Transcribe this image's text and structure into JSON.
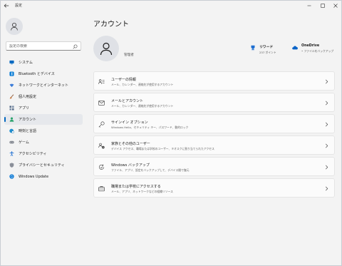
{
  "window": {
    "title": "設定"
  },
  "search": {
    "placeholder": "設定の検索"
  },
  "sidebar": {
    "items": [
      {
        "label": "システム",
        "icon": "monitor-icon",
        "color": "#0067c0"
      },
      {
        "label": "Bluetooth とデバイス",
        "icon": "bluetooth-icon",
        "color": "#0078d4"
      },
      {
        "label": "ネットワークとインターネット",
        "icon": "wifi-icon",
        "color": "#3b7bd8"
      },
      {
        "label": "個人用設定",
        "icon": "brush-icon",
        "color": "#c4743a"
      },
      {
        "label": "アプリ",
        "icon": "apps-icon",
        "color": "#5a6f8a"
      },
      {
        "label": "アカウント",
        "icon": "person-icon",
        "color": "#2aa36b",
        "active": true
      },
      {
        "label": "時刻と言語",
        "icon": "globe-clock-icon",
        "color": "#1f8fd0"
      },
      {
        "label": "ゲーム",
        "icon": "gamepad-icon",
        "color": "#7a7f88"
      },
      {
        "label": "アクセシビリティ",
        "icon": "accessibility-icon",
        "color": "#1f6fd1"
      },
      {
        "label": "プライバシーとセキュリティ",
        "icon": "shield-icon",
        "color": "#8a8f99"
      },
      {
        "label": "Windows Update",
        "icon": "update-icon",
        "color": "#0a78d4"
      }
    ]
  },
  "main": {
    "title": "アカウント",
    "account_role": "管理者",
    "rewards": {
      "title": "リワード",
      "sub": "237 ポイント"
    },
    "onedrive": {
      "title": "OneDrive",
      "sub": "• ファイルをバックアップ"
    },
    "cards": [
      {
        "title": "ユーザーの情報",
        "sub": "メール、カレンダー、連絡先が使用するアカウント",
        "icon": "user-info-icon"
      },
      {
        "title": "メールとアカウント",
        "sub": "メール、カレンダー、連絡先が使用するアカウント",
        "icon": "mail-icon"
      },
      {
        "title": "サインイン オプション",
        "sub": "Windows Hello、セキュリティ キー、パスワード、動的ロック",
        "icon": "key-icon"
      },
      {
        "title": "家族とその他のユーザー",
        "sub": "デバイス アクセス、職場または学校のユーザー、キオスクに割り当てられたアクセス",
        "icon": "family-icon"
      },
      {
        "title": "Windows バックアップ",
        "sub": "ファイル、アプリ、設定をバックアップして、デバイス間で復元",
        "icon": "backup-icon"
      },
      {
        "title": "職場または学校にアクセスする",
        "sub": "メール、アプリ、ネットワークなどの組織リソース",
        "icon": "briefcase-icon"
      }
    ]
  },
  "colors": {
    "accent": "#0067c0"
  }
}
